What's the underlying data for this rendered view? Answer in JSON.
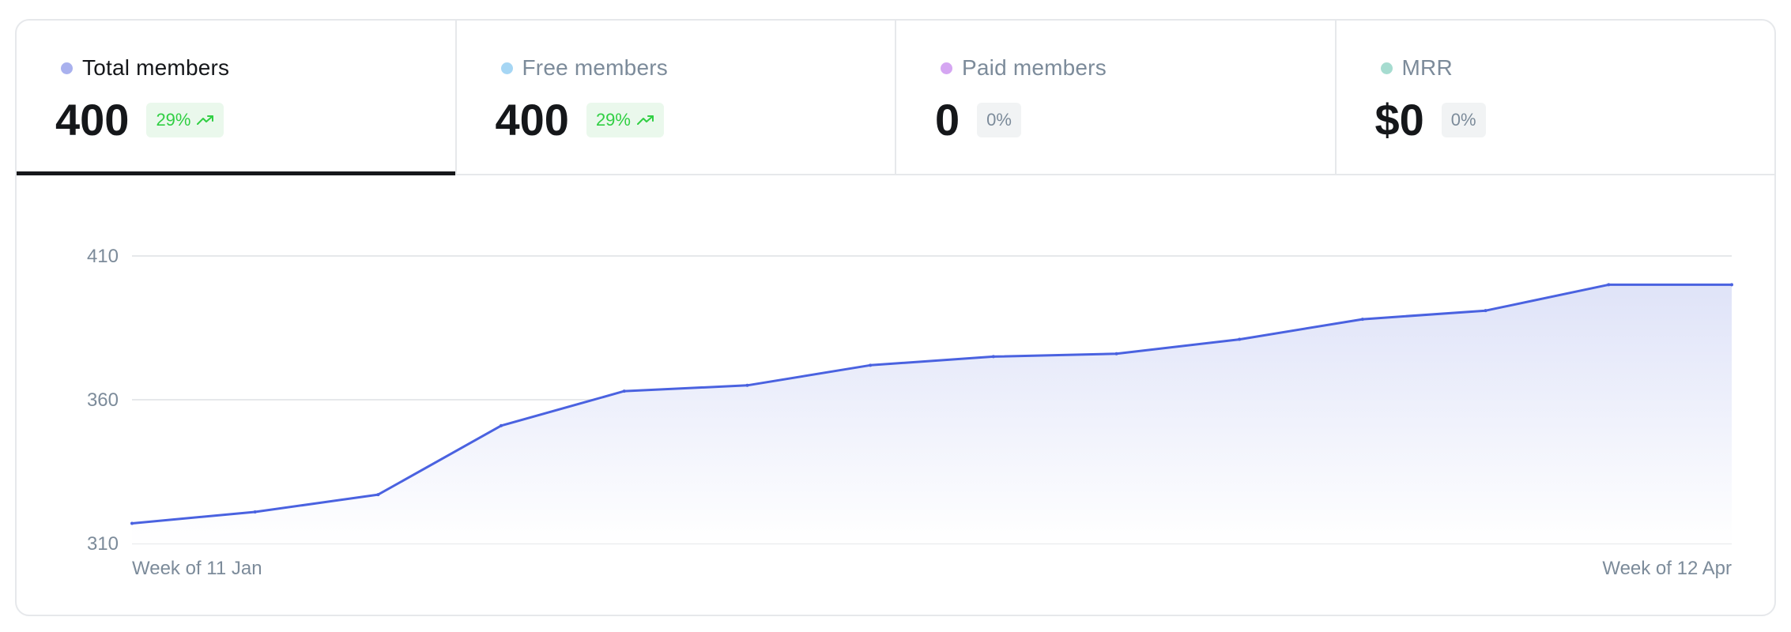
{
  "tabs": [
    {
      "label": "Total members",
      "value": "400",
      "badge": "29%",
      "trend": "up",
      "dot_color": "#a9b1ee",
      "active": true
    },
    {
      "label": "Free members",
      "value": "400",
      "badge": "29%",
      "trend": "up",
      "dot_color": "#a6d6f4",
      "active": false
    },
    {
      "label": "Paid members",
      "value": "0",
      "badge": "0%",
      "trend": "none",
      "dot_color": "#d5a6f2",
      "active": false
    },
    {
      "label": "MRR",
      "value": "$0",
      "badge": "0%",
      "trend": "none",
      "dot_color": "#a6dcd0",
      "active": false
    }
  ],
  "colors": {
    "line": "#4a62e0",
    "area_top": "#dfe3f8",
    "grid": "#e6e8eb",
    "positive": "#30cf43",
    "muted_text": "#7c8b9a"
  },
  "chart_data": {
    "type": "area",
    "series": [
      {
        "values": [
          317,
          321,
          327,
          351,
          363,
          365,
          372,
          375,
          376,
          381,
          388,
          391,
          400,
          400
        ]
      }
    ],
    "ylim": [
      310,
      410
    ],
    "yticks": [
      "410",
      "360",
      "310"
    ],
    "ytick_values": [
      410,
      360,
      310
    ],
    "x_labels": {
      "start": "Week of 11 Jan",
      "end": "Week of 12 Apr"
    },
    "grid": true
  }
}
